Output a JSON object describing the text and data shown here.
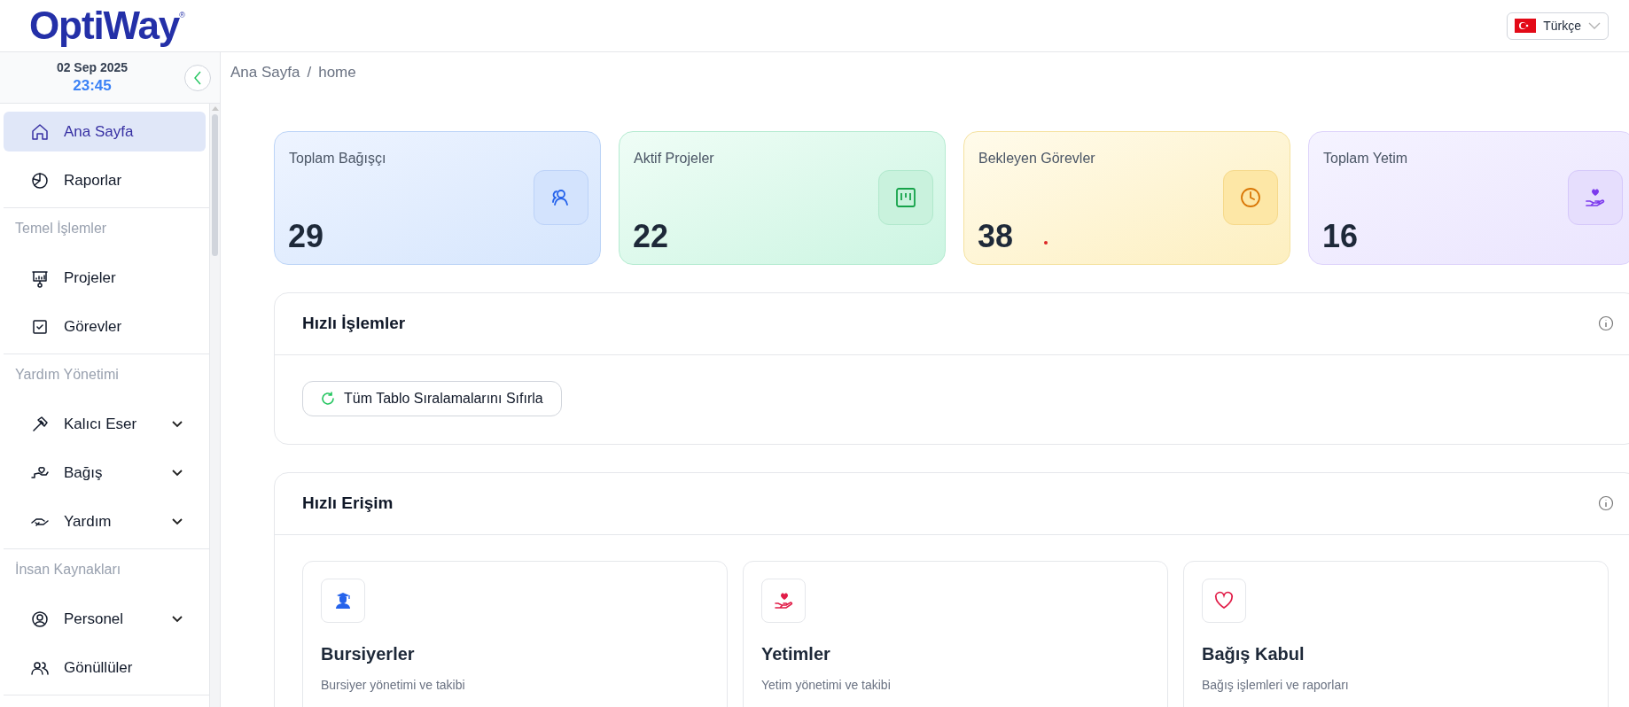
{
  "header": {
    "logo": "OptiWay",
    "logo_mark": "®",
    "language": "Türkçe"
  },
  "clock": {
    "date": "02 Sep 2025",
    "time": "23:45"
  },
  "sidebar": {
    "items": [
      {
        "kind": "item",
        "label": "Ana Sayfa",
        "selected": true
      },
      {
        "kind": "item",
        "label": "Raporlar",
        "selected": false
      },
      {
        "kind": "heading",
        "label": "Temel İşlemler"
      },
      {
        "kind": "item",
        "label": "Projeler",
        "selected": false
      },
      {
        "kind": "item",
        "label": "Görevler",
        "selected": false
      },
      {
        "kind": "heading",
        "label": "Yardım Yönetimi"
      },
      {
        "kind": "group",
        "label": "Kalıcı Eser",
        "expanded": false
      },
      {
        "kind": "group",
        "label": "Bağış",
        "expanded": false
      },
      {
        "kind": "group",
        "label": "Yardım",
        "expanded": false
      },
      {
        "kind": "heading",
        "label": "İnsan Kaynakları"
      },
      {
        "kind": "group",
        "label": "Personel",
        "expanded": false
      },
      {
        "kind": "item",
        "label": "Gönüllüler",
        "selected": false
      }
    ]
  },
  "breadcrumb": [
    "Ana Sayfa",
    "/",
    "home"
  ],
  "stats": [
    {
      "label": "Toplam Bağışçı",
      "value": "29",
      "color": "#2563eb"
    },
    {
      "label": "Aktif Projeler",
      "value": "22",
      "color": "#16a34a"
    },
    {
      "label": "Bekleyen Görevler",
      "value": "38",
      "color": "#d97706"
    },
    {
      "label": "Toplam Yetim",
      "value": "16",
      "color": "#7c3aed"
    }
  ],
  "quick_actions": {
    "title": "Hızlı İşlemler",
    "buttons": [
      "Tüm Tablo Sıralamalarını Sıfırla"
    ]
  },
  "quick_access": {
    "title": "Hızlı Erişim",
    "cards": [
      {
        "title": "Bursiyerler",
        "description": "Bursiyer yönetimi ve takibi",
        "color": "#2563eb"
      },
      {
        "title": "Yetimler",
        "description": "Yetim yönetimi ve takibi",
        "color": "#e11d48"
      },
      {
        "title": "Bağış Kabul",
        "description": "Bağış işlemleri ve raporları",
        "color": "#e11d48"
      }
    ]
  }
}
